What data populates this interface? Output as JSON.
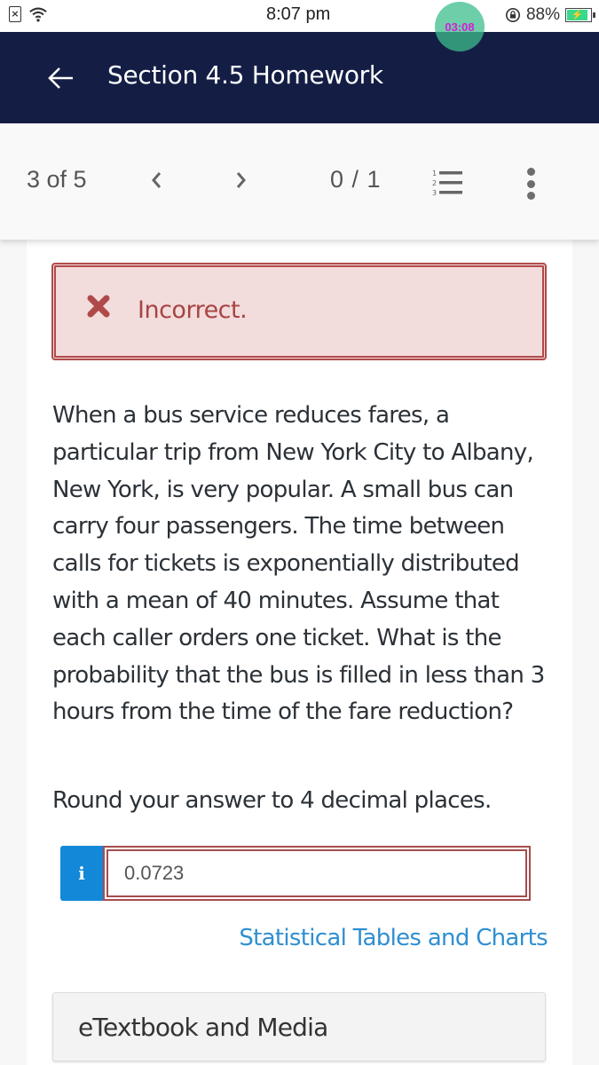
{
  "status_bar": {
    "time": "8:07 pm",
    "battery_percent": "88%",
    "battery_level": 0.88,
    "timer_overlay": "03:08",
    "icons": [
      "sim-error-icon",
      "wifi-icon",
      "rotation-lock-icon",
      "battery-charging-icon"
    ]
  },
  "header": {
    "back_icon": "arrow-left-icon",
    "title": "Section 4.5 Homework"
  },
  "nav": {
    "position": "3 of 5",
    "prev_icon": "chevron-left-icon",
    "next_icon": "chevron-right-icon",
    "score": "0 / 1",
    "list_icon": "numbered-list-icon",
    "more_icon": "more-vertical-icon"
  },
  "feedback": {
    "status": "Incorrect.",
    "icon": "x-mark-icon",
    "colors": {
      "background": "#f3dcdc",
      "border": "#b04a4a",
      "text": "#a74444"
    }
  },
  "question": {
    "text": "When a bus service reduces fares, a particular trip from New York City to Albany, New York, is very popular. A small bus can carry four passengers. The time between calls for tickets is exponentially distributed with a mean of 40 minutes. Assume that each caller orders one ticket. What is the probability that the bus is filled in less than 3 hours from the time of the fare reduction?",
    "instruction": "Round your answer to 4 decimal places."
  },
  "answer": {
    "info_label": "i",
    "value": "0.0723"
  },
  "links": {
    "stat_tables": "Statistical Tables and Charts",
    "etextbook": "eTextbook and Media"
  },
  "colors": {
    "header_bg": "#141e45",
    "accent_blue": "#1388d8",
    "link_blue": "#2f8fd1"
  }
}
